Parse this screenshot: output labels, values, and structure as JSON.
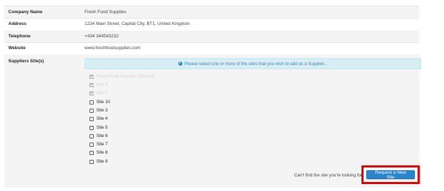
{
  "details": {
    "company_name_label": "Company Name",
    "company_name_value": "Fresh Food Supplies",
    "address_label": "Address",
    "address_value": "1234 Main Street, Capital City, BT1, United Kingdom",
    "telephone_label": "Telephone",
    "telephone_value": "+434 344543232",
    "website_label": "Website",
    "website_value": "www.freshfoodsupplies.com",
    "suppliers_label": "Suppliers Site(s)"
  },
  "info_message": "Please select one or more of the sites that you wish to add as a Supplier...",
  "sites": [
    {
      "label": "Fresh Food Supplies (Default)",
      "checked": true
    },
    {
      "label": "Site 2",
      "checked": true
    },
    {
      "label": "Site 1",
      "checked": true
    },
    {
      "label": "Site 10",
      "checked": false
    },
    {
      "label": "Site 3",
      "checked": false
    },
    {
      "label": "Site 4",
      "checked": false
    },
    {
      "label": "Site 5",
      "checked": false
    },
    {
      "label": "Site 6",
      "checked": false
    },
    {
      "label": "Site 7",
      "checked": false
    },
    {
      "label": "Site 8",
      "checked": false
    },
    {
      "label": "Site 9",
      "checked": false
    }
  ],
  "footer": {
    "cant_find_text": "Can't find the site you're looking for",
    "request_button_label": "Request a New Site"
  },
  "colors": {
    "button": "#2a86cc",
    "highlight": "#e00000",
    "info_bg": "#d9edf7"
  }
}
